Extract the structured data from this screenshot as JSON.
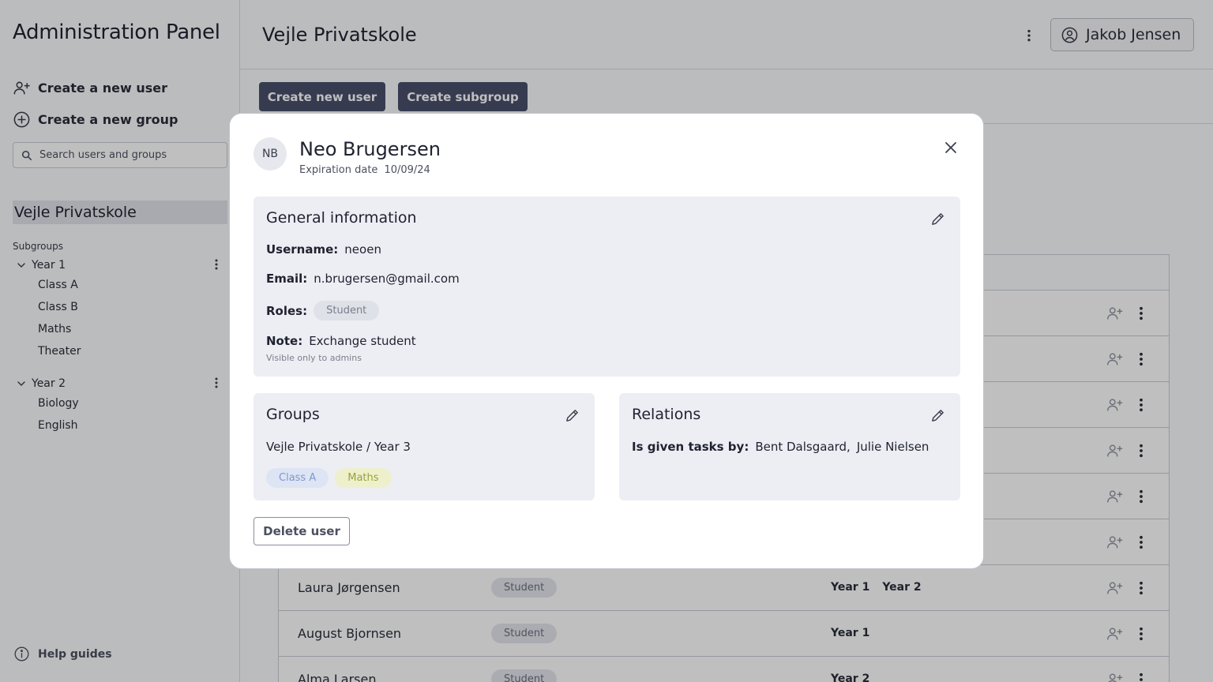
{
  "sidebar": {
    "app_title": "Administration Panel",
    "create_user": "Create a new user",
    "create_group": "Create a new group",
    "search_placeholder": "Search users and groups",
    "root_group": "Vejle Privatskole",
    "subgroups_label": "Subgroups",
    "tree": [
      {
        "label": "Year 1",
        "children": [
          "Class A",
          "Class B",
          "Maths",
          "Theater"
        ]
      },
      {
        "label": "Year 2",
        "children": [
          "Biology",
          "English"
        ]
      }
    ],
    "help": "Help guides"
  },
  "header": {
    "title": "Vejle Privatskole",
    "user_name": "Jakob Jensen"
  },
  "toolbar": {
    "create_user": "Create new user",
    "create_subgroup": "Create subgroup"
  },
  "table": {
    "rows": [
      {
        "name": "",
        "role": "",
        "groups": []
      },
      {
        "name": "",
        "role": "",
        "groups": []
      },
      {
        "name": "",
        "role": "",
        "groups": []
      },
      {
        "name": "",
        "role": "",
        "groups": []
      },
      {
        "name": "",
        "role": "",
        "groups": []
      },
      {
        "name": "",
        "role": "",
        "groups": []
      },
      {
        "name": "Laura Jørgensen",
        "role": "Student",
        "groups": [
          "Year 1",
          "Year 2"
        ]
      },
      {
        "name": "August Bjornsen",
        "role": "Student",
        "groups": [
          "Year 1"
        ]
      },
      {
        "name": "Alma Larsen",
        "role": "Student",
        "groups": [
          "Year 2"
        ]
      }
    ]
  },
  "modal": {
    "initials": "NB",
    "name": "Neo Brugersen",
    "expiration_label": "Expiration date",
    "expiration_value": "10/09/24",
    "general": {
      "title": "General information",
      "username_label": "Username:",
      "username": "neoen",
      "email_label": "Email:",
      "email": "n.brugersen@gmail.com",
      "roles_label": "Roles:",
      "role": "Student",
      "note_label": "Note:",
      "note": "Exchange student",
      "note_hint": "Visible only to admins"
    },
    "groups": {
      "title": "Groups",
      "path": "Vejle Privatskole / Year 3",
      "chips": [
        "Class A",
        "Maths"
      ]
    },
    "relations": {
      "title": "Relations",
      "label": "Is given tasks by:",
      "people": [
        "Bent Dalsgaard,",
        "Julie Nielsen"
      ]
    },
    "delete": "Delete user"
  },
  "colors": {
    "accent_button": "#484f6b",
    "chip_blue_bg": "#dde5f5",
    "chip_blue_text": "#7f97c9",
    "chip_green_bg": "#eef0cc",
    "chip_green_text": "#9aa23a"
  }
}
